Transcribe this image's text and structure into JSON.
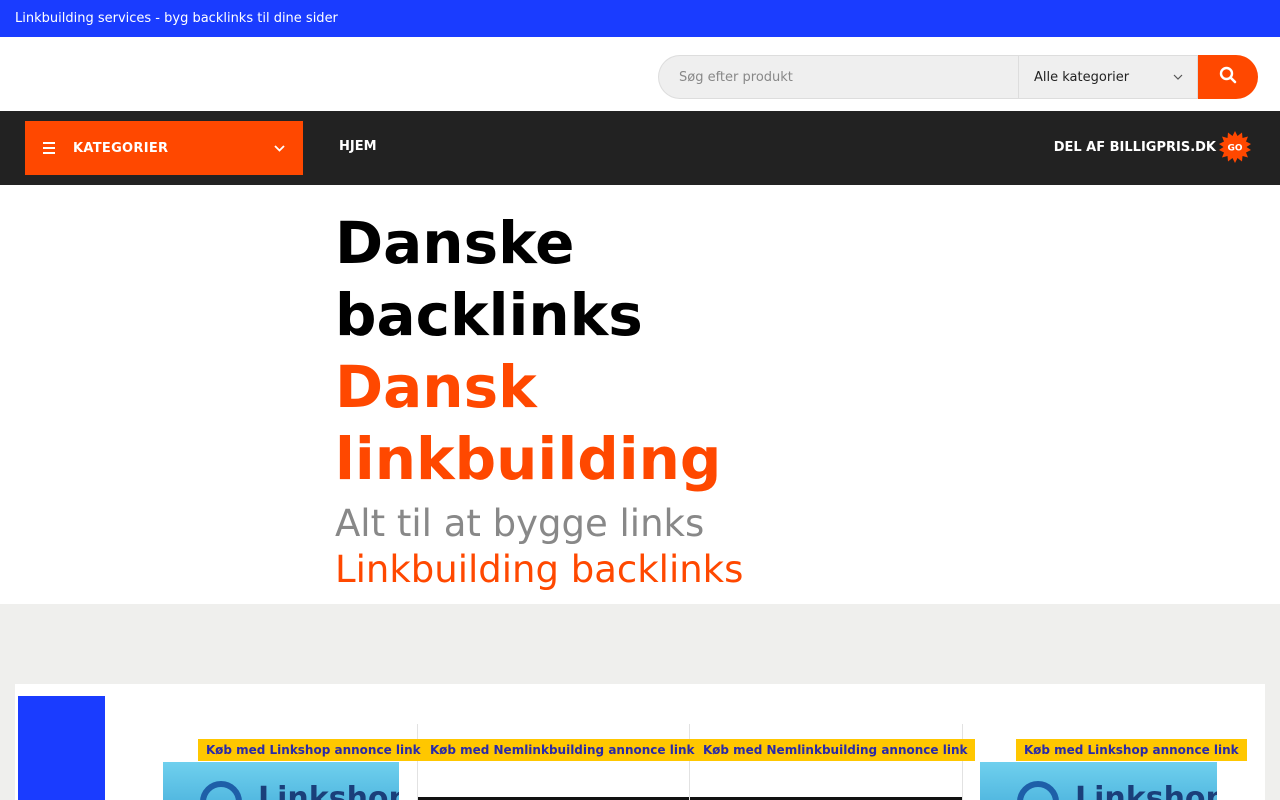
{
  "topbar": {
    "text": "Linkbuilding services - byg backlinks til dine sider"
  },
  "search": {
    "placeholder": "Søg efter produkt",
    "category_value": "Alle kategorier",
    "search_icon": "search-icon"
  },
  "nav": {
    "categories_label": "KATEGORIER",
    "home_label": "HJEM",
    "partner_label": "DEL AF BILLIGPRIS.DK",
    "badge_text": "GO"
  },
  "hero": {
    "line1": "Danske",
    "line2": "backlinks",
    "line3": "Dansk",
    "line4": "linkbuilding",
    "line5": "Alt til at bygge links",
    "line6": "Linkbuilding backlinks"
  },
  "products": [
    {
      "tag": "Køb med Linkshop annonce link",
      "thumb_text": "Linkshop"
    },
    {
      "tag": "Køb med Nemlinkbuilding annonce link"
    },
    {
      "tag": "Køb med Nemlinkbuilding annonce link"
    },
    {
      "tag": "Køb med Linkshop annonce link",
      "thumb_text": "Linkshop"
    }
  ],
  "colors": {
    "accent": "#ff4800",
    "topbar": "#1a3cff",
    "navbar": "#222222",
    "tag": "#ffc700"
  }
}
